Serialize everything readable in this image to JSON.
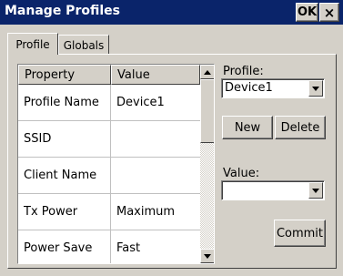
{
  "window": {
    "title": "Manage Profiles",
    "ok_label": "OK",
    "close_label": "×"
  },
  "tabs": [
    {
      "label": "Profile",
      "active": true
    },
    {
      "label": "Globals",
      "active": false
    }
  ],
  "grid": {
    "columns": [
      "Property",
      "Value"
    ],
    "rows": [
      {
        "property": "Profile Name",
        "value": "Device1"
      },
      {
        "property": "SSID",
        "value": ""
      },
      {
        "property": "Client Name",
        "value": ""
      },
      {
        "property": "Tx Power",
        "value": "Maximum"
      },
      {
        "property": "Power Save",
        "value": "Fast"
      }
    ]
  },
  "profile": {
    "label": "Profile:",
    "selected": "Device1",
    "new_label": "New",
    "delete_label": "Delete"
  },
  "value_field": {
    "label": "Value:",
    "selected": ""
  },
  "commit_label": "Commit",
  "icons": {
    "dropdown": "chevron-down-icon",
    "scroll_up": "triangle-up-icon",
    "scroll_down": "triangle-down-icon"
  }
}
